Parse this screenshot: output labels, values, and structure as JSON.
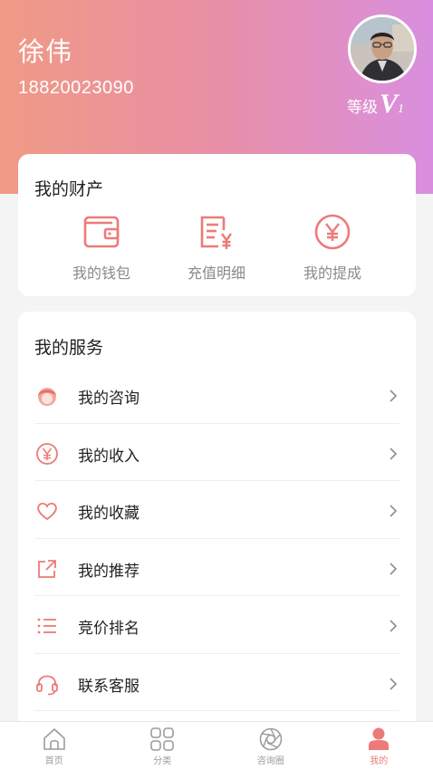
{
  "profile": {
    "name": "徐伟",
    "phone": "18820023090",
    "level_label": "等级",
    "level_v": "V",
    "level_num": "1"
  },
  "assets": {
    "title": "我的财产",
    "items": [
      {
        "label": "我的钱包",
        "icon": "wallet-icon"
      },
      {
        "label": "充值明细",
        "icon": "recharge-detail-icon"
      },
      {
        "label": "我的提成",
        "icon": "yen-circle-icon"
      }
    ]
  },
  "services": {
    "title": "我的服务",
    "items": [
      {
        "label": "我的咨询",
        "icon": "consult-icon"
      },
      {
        "label": "我的收入",
        "icon": "yen-circle-icon"
      },
      {
        "label": "我的收藏",
        "icon": "heart-icon"
      },
      {
        "label": "我的推荐",
        "icon": "share-icon"
      },
      {
        "label": "竞价排名",
        "icon": "list-icon"
      },
      {
        "label": "联系客服",
        "icon": "headset-icon"
      }
    ]
  },
  "tabbar": {
    "items": [
      {
        "label": "首页",
        "icon": "home-icon"
      },
      {
        "label": "分类",
        "icon": "category-icon"
      },
      {
        "label": "咨询圈",
        "icon": "aperture-icon"
      },
      {
        "label": "我的",
        "icon": "user-icon"
      }
    ],
    "active_index": 3
  },
  "colors": {
    "accent": "#ec7b78",
    "header_gradient_start": "#f09a86",
    "header_gradient_end": "#d98fdf"
  }
}
